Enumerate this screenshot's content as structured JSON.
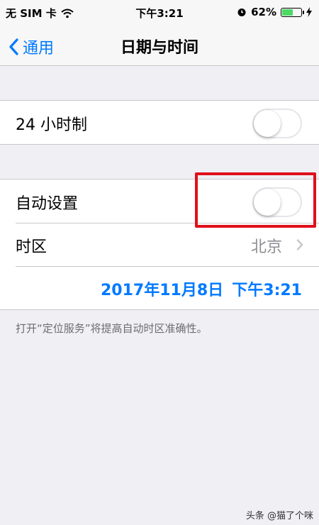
{
  "status_bar": {
    "carrier": "无 SIM 卡",
    "time": "下午3:21",
    "battery_percent": "62%",
    "battery_level": 0.62,
    "icons": [
      "wifi-icon",
      "alarm-icon",
      "battery-icon",
      "charging-bolt-icon"
    ]
  },
  "nav": {
    "back_label": "通用",
    "title": "日期与时间"
  },
  "settings": {
    "clock_24h": {
      "label": "24 小时制",
      "on": false
    },
    "auto_set": {
      "label": "自动设置",
      "on": false
    },
    "timezone": {
      "label": "时区",
      "value": "北京"
    },
    "date": "2017年11月8日",
    "time": "下午3:21"
  },
  "footer_note": "打开“定位服务”将提高自动时区准确性。",
  "watermark": "头条 @猫了个咪",
  "colors": {
    "accent": "#007aff",
    "background": "#efeff4",
    "highlight": "#e0101a",
    "battery_fill": "#4cd964"
  }
}
